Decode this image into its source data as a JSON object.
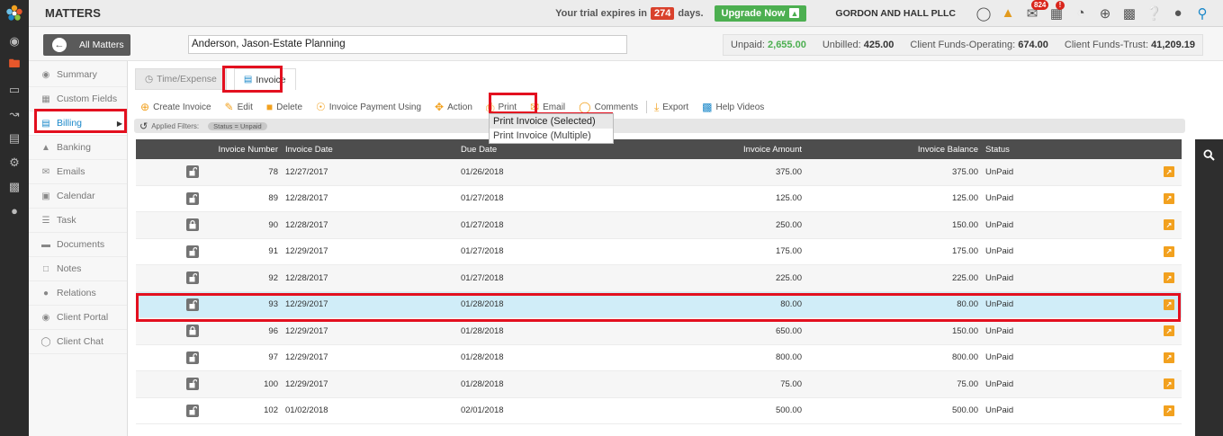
{
  "app": {
    "title": "MATTERS"
  },
  "trial": {
    "prefix": "Your trial expires in",
    "days": "274",
    "suffix": "days."
  },
  "upgrade": {
    "label": "Upgrade Now"
  },
  "firm": {
    "name": "GORDON AND HALL PLLC"
  },
  "topbar_icons": [
    {
      "name": "chat-icon"
    },
    {
      "name": "bank-icon"
    },
    {
      "name": "mail-icon",
      "badge": "824"
    },
    {
      "name": "calendar-alert-icon",
      "badge": "!"
    },
    {
      "name": "timer-icon"
    },
    {
      "name": "plus-circle-icon"
    },
    {
      "name": "film-icon"
    },
    {
      "name": "help-icon"
    },
    {
      "name": "user-icon"
    },
    {
      "name": "lightbulb-icon"
    }
  ],
  "subbar": {
    "all_matters": "All Matters",
    "matter_name": "Anderson, Jason-Estate Planning",
    "unpaid_label": "Unpaid:",
    "unpaid_value": "2,655.00",
    "unbilled_label": "Unbilled:",
    "unbilled_value": "425.00",
    "funds_op_label": "Client Funds-Operating:",
    "funds_op_value": "674.00",
    "funds_trust_label": "Client Funds-Trust:",
    "funds_trust_value": "41,209.19"
  },
  "sidebar": {
    "items": [
      {
        "label": "Summary",
        "icon": "dashboard-icon"
      },
      {
        "label": "Custom Fields",
        "icon": "grid-icon"
      },
      {
        "label": "Billing",
        "icon": "billing-icon"
      },
      {
        "label": "Banking",
        "icon": "bank-icon"
      },
      {
        "label": "Emails",
        "icon": "mail-icon"
      },
      {
        "label": "Calendar",
        "icon": "calendar-icon"
      },
      {
        "label": "Task",
        "icon": "list-icon"
      },
      {
        "label": "Documents",
        "icon": "folder-icon"
      },
      {
        "label": "Notes",
        "icon": "note-icon"
      },
      {
        "label": "Relations",
        "icon": "users-icon"
      },
      {
        "label": "Client Portal",
        "icon": "portal-icon"
      },
      {
        "label": "Client Chat",
        "icon": "chat-icon"
      }
    ]
  },
  "tabs": {
    "time_expense": "Time/Expense",
    "invoice": "Invoice"
  },
  "toolbar": {
    "create": "Create Invoice",
    "edit": "Edit",
    "delete": "Delete",
    "payment": "Invoice Payment Using",
    "action": "Action",
    "print": "Print",
    "email": "Email",
    "comments": "Comments",
    "export": "Export",
    "help_videos": "Help Videos"
  },
  "filters": {
    "label": "Applied Filters:",
    "pill": "Status = Unpaid"
  },
  "print_menu": {
    "selected": "Print Invoice (Selected)",
    "multiple": "Print Invoice (Multiple)"
  },
  "table": {
    "headers": {
      "number": "Invoice Number",
      "date": "Invoice Date",
      "due": "Due Date",
      "amount": "Invoice Amount",
      "balance": "Invoice Balance",
      "status": "Status"
    },
    "rows": [
      {
        "number": "78",
        "date": "12/27/2017",
        "due": "01/26/2018",
        "amount": "375.00",
        "balance": "375.00",
        "status": "UnPaid",
        "lock": "unlocked"
      },
      {
        "number": "89",
        "date": "12/28/2017",
        "due": "01/27/2018",
        "amount": "125.00",
        "balance": "125.00",
        "status": "UnPaid",
        "lock": "unlocked"
      },
      {
        "number": "90",
        "date": "12/28/2017",
        "due": "01/27/2018",
        "amount": "250.00",
        "balance": "150.00",
        "status": "UnPaid",
        "lock": "locked"
      },
      {
        "number": "91",
        "date": "12/29/2017",
        "due": "01/27/2018",
        "amount": "175.00",
        "balance": "175.00",
        "status": "UnPaid",
        "lock": "unlocked"
      },
      {
        "number": "92",
        "date": "12/28/2017",
        "due": "01/27/2018",
        "amount": "225.00",
        "balance": "225.00",
        "status": "UnPaid",
        "lock": "unlocked"
      },
      {
        "number": "93",
        "date": "12/29/2017",
        "due": "01/28/2018",
        "amount": "80.00",
        "balance": "80.00",
        "status": "UnPaid",
        "lock": "unlocked",
        "selected": true
      },
      {
        "number": "96",
        "date": "12/29/2017",
        "due": "01/28/2018",
        "amount": "650.00",
        "balance": "150.00",
        "status": "UnPaid",
        "lock": "locked"
      },
      {
        "number": "97",
        "date": "12/29/2017",
        "due": "01/28/2018",
        "amount": "800.00",
        "balance": "800.00",
        "status": "UnPaid",
        "lock": "unlocked"
      },
      {
        "number": "100",
        "date": "12/29/2017",
        "due": "01/28/2018",
        "amount": "75.00",
        "balance": "75.00",
        "status": "UnPaid",
        "lock": "unlocked"
      },
      {
        "number": "102",
        "date": "01/02/2018",
        "due": "02/01/2018",
        "amount": "500.00",
        "balance": "500.00",
        "status": "UnPaid",
        "lock": "unlocked"
      }
    ]
  }
}
